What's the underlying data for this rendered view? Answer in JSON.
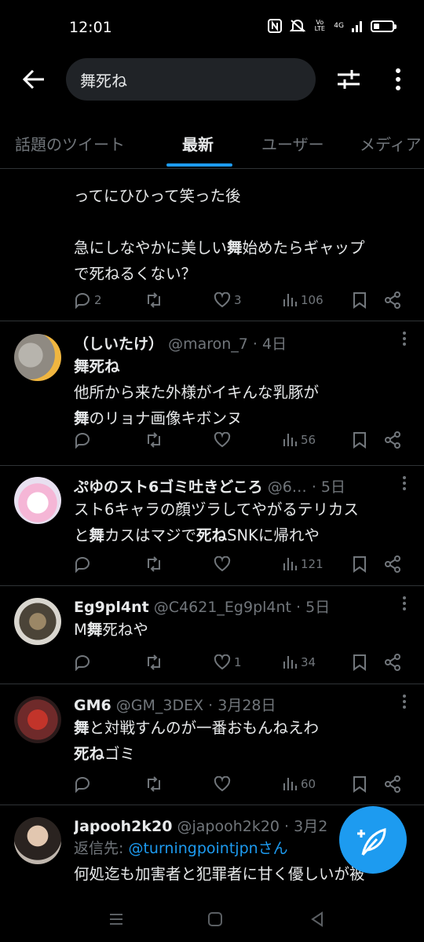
{
  "status_bar": {
    "time": "12:01",
    "network": "4G",
    "volte": "Vo LTE"
  },
  "search": {
    "query": "舞死ね"
  },
  "tabs": [
    {
      "label": "話題のツイート",
      "active": false
    },
    {
      "label": "最新",
      "active": true
    },
    {
      "label": "ユーザー",
      "active": false
    },
    {
      "label": "メディア",
      "active": false
    }
  ],
  "tweets": [
    {
      "partial": true,
      "text_line1": "ってにひひって笑った後",
      "text_line2a": "急にしなやかに美しい",
      "text_line2b": "舞",
      "text_line2c": "始めたらギャップ",
      "text_line3": "で死ねるくない？",
      "replies": "2",
      "likes": "3",
      "views": "106"
    },
    {
      "name": "（しいたけ）",
      "handle": "@maron_7 · 4日",
      "line1": "舞死ね",
      "line2": "他所から来た外様がイキんな乳豚が",
      "line3a": "舞",
      "line3b": "のリョナ画像キボンヌ",
      "views": "56"
    },
    {
      "name": "ぷゆのスト6ゴミ吐きどころ",
      "handle": "@6… · 5日",
      "line1": "スト6キャラの顔ヅラしてやがるテリカス",
      "line2a": "と",
      "line2b": "舞",
      "line2c": "カスはマジで",
      "line2d": "死ね",
      "line2e": "SNKに帰れや",
      "views": "121"
    },
    {
      "name": "Eg9pl4nt",
      "handle": "@C4621_Eg9pl4nt · 5日",
      "line1a": "M",
      "line1b": "舞",
      "line1c": "死ねや",
      "likes": "1",
      "views": "34"
    },
    {
      "name": "GM6",
      "handle": "@GM_3DEX · 3月28日",
      "line1a": "舞",
      "line1b": "と対戦すんのが一番おもんねえわ",
      "line2a": "死ね",
      "line2b": "ゴミ",
      "views": "60"
    },
    {
      "name": "Japooh2k20",
      "handle": "@japooh2k20 · 3月2",
      "reply_prefix": "返信先: ",
      "reply_link": "@turningpointjpnさん",
      "line1": "何処迄も加害者と犯罪者に甘く優しいが被"
    }
  ],
  "colors": {
    "accent": "#1d9bf0",
    "background": "#000000",
    "muted": "#71767b",
    "text": "#e7e9ea"
  },
  "icons": [
    "back-arrow-icon",
    "filter-icon",
    "more-vertical-icon",
    "reply-icon",
    "retweet-icon",
    "like-icon",
    "views-icon",
    "bookmark-icon",
    "share-icon",
    "compose-icon"
  ]
}
